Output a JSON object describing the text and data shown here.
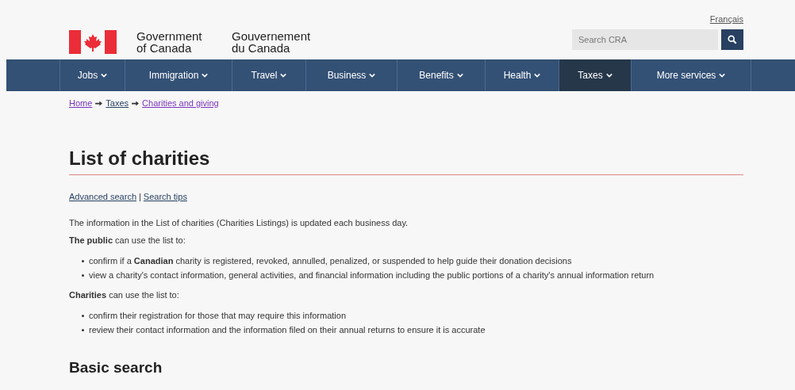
{
  "header": {
    "language_link": "Français",
    "signature": {
      "english": [
        "Government",
        "of Canada"
      ],
      "french": [
        "Gouvernement",
        "du Canada"
      ]
    },
    "search": {
      "placeholder": "Search CRA"
    }
  },
  "nav": [
    {
      "label": "Jobs",
      "selected": false
    },
    {
      "label": "Immigration",
      "selected": false
    },
    {
      "label": "Travel",
      "selected": false
    },
    {
      "label": "Business",
      "selected": false
    },
    {
      "label": "Benefits",
      "selected": false
    },
    {
      "label": "Health",
      "selected": false
    },
    {
      "label": "Taxes",
      "selected": true
    },
    {
      "label": "More services",
      "selected": false
    }
  ],
  "breadcrumb": [
    "Home",
    "Taxes",
    "Charities and giving"
  ],
  "title": "List of charities",
  "links": [
    "Advanced search",
    "Search tips"
  ],
  "link_separator": "|",
  "intro": "The information in the List of charities (Charities Listings) is updated each business day.",
  "sections": [
    {
      "lead": "**The public** can use the list to:",
      "bullets": [
        "confirm if a **Canadian** charity is registered, revoked, annulled, penalized, or suspended to help guide their donation decisions",
        "view a charity's contact information, general activities, and financial information including the public portions of a charity's annual information return"
      ]
    },
    {
      "lead": "**Charities** can use the list to:",
      "bullets": [
        "confirm their registration for those that may require this information",
        "review their contact information and the information filed on their annual returns to ensure it is accurate"
      ]
    }
  ],
  "subheading": "Basic search"
}
